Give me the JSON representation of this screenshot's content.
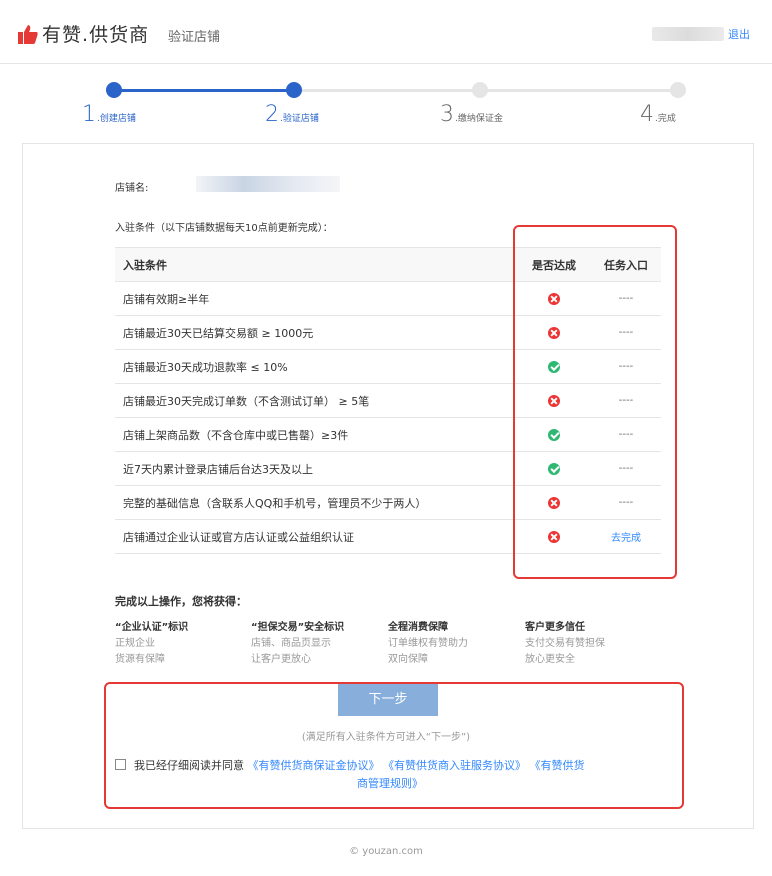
{
  "header": {
    "brand": "有赞",
    "brand_dot": ".",
    "brand_suffix": "供货商",
    "page_subtitle": "验证店铺",
    "logout_label": "退出"
  },
  "steps": [
    {
      "num": "1",
      "label": ".创建店铺",
      "state": "done"
    },
    {
      "num": "2",
      "label": ".验证店铺",
      "state": "current"
    },
    {
      "num": "3",
      "label": ".缴纳保证金",
      "state": "todo"
    },
    {
      "num": "4",
      "label": ".完成",
      "state": "todo"
    }
  ],
  "store": {
    "label": "店铺名:"
  },
  "conditions_note": "入驻条件（以下店铺数据每天10点前更新完成）：",
  "table": {
    "headers": {
      "condition": "入驻条件",
      "status": "是否达成",
      "entry": "任务入口"
    },
    "rows": [
      {
        "condition": "店铺有效期≥半年",
        "status": "fail",
        "entry": "----"
      },
      {
        "condition": "店铺最近30天已结算交易额 ≥ 1000元",
        "status": "fail",
        "entry": "----"
      },
      {
        "condition": "店铺最近30天成功退款率 ≤ 10%",
        "status": "ok",
        "entry": "----"
      },
      {
        "condition": "店铺最近30天完成订单数（不含测试订单） ≥ 5笔",
        "status": "fail",
        "entry": "----"
      },
      {
        "condition": "店铺上架商品数（不含仓库中或已售罄）≥3件",
        "status": "ok",
        "entry": "----"
      },
      {
        "condition": "近7天内累计登录店铺后台达3天及以上",
        "status": "ok",
        "entry": "----"
      },
      {
        "condition": "完整的基础信息（含联系人QQ和手机号，管理员不少于两人）",
        "status": "fail",
        "entry": "----"
      },
      {
        "condition": "店铺通过企业认证或官方店认证或公益组织认证",
        "status": "fail",
        "entry": "去完成"
      }
    ]
  },
  "benefits": {
    "title": "完成以上操作，您将获得：",
    "items": [
      {
        "title": "“企业认证”标识",
        "line1": "正规企业",
        "line2": "货源有保障"
      },
      {
        "title": "“担保交易”安全标识",
        "line1": "店铺、商品页显示",
        "line2": "让客户更放心"
      },
      {
        "title": "全程消费保障",
        "line1": "订单维权有赞助力",
        "line2": "双向保障"
      },
      {
        "title": "客户更多信任",
        "line1": "支付交易有赞担保",
        "line2": "放心更安全"
      }
    ]
  },
  "actions": {
    "next_label": "下一步",
    "next_hint": "(满足所有入驻条件方可进入“下一步”)",
    "agree_prefix": "我已经仔细阅读并同意",
    "agreement_1": "《有赞供货商保证金协议》",
    "agreement_2": "《有赞供货商入驻服务协议》",
    "agreement_3_part1": "《有赞供货",
    "agreement_3_part2": "商管理规则》"
  },
  "footer": "© youzan.com",
  "colors": {
    "accent": "#3388ff",
    "ok": "#2eb872",
    "fail": "#ee3333",
    "highlight": "#e53935",
    "next_button": "#88aedb"
  }
}
